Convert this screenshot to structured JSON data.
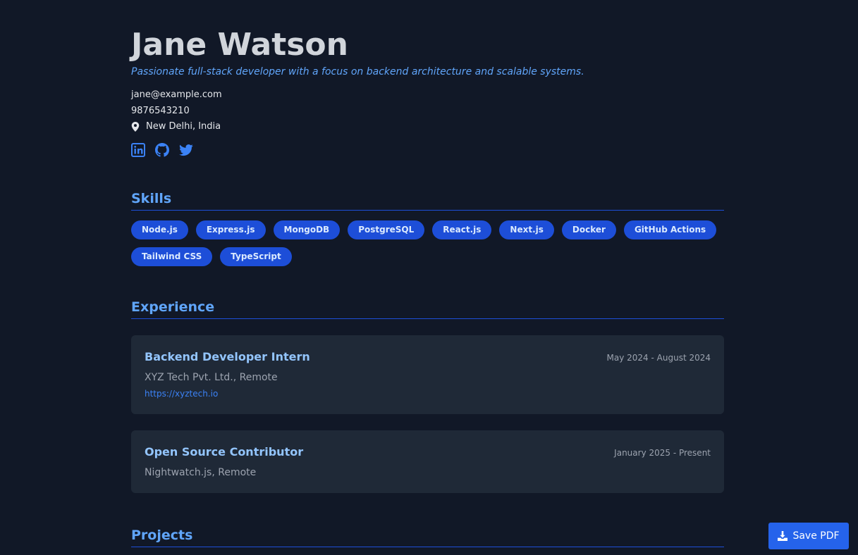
{
  "profile": {
    "name": "Jane Watson",
    "tagline": "Passionate full-stack developer with a focus on backend architecture and scalable systems.",
    "email": "jane@example.com",
    "phone": "9876543210",
    "location": "New Delhi, India"
  },
  "socials": [
    {
      "icon": "linkedin-icon"
    },
    {
      "icon": "github-icon"
    },
    {
      "icon": "twitter-icon"
    }
  ],
  "sections": {
    "skills": "Skills",
    "experience": "Experience",
    "projects": "Projects"
  },
  "skills": [
    "Node.js",
    "Express.js",
    "MongoDB",
    "PostgreSQL",
    "React.js",
    "Next.js",
    "Docker",
    "GitHub Actions",
    "Tailwind CSS",
    "TypeScript"
  ],
  "experience": [
    {
      "title": "Backend Developer Intern",
      "dates": "May 2024 - August 2024",
      "company": "XYZ Tech Pvt. Ltd., Remote",
      "link": "https://xyztech.io"
    },
    {
      "title": "Open Source Contributor",
      "dates": "January 2025 - Present",
      "company": "Nightwatch.js, Remote"
    }
  ],
  "actions": {
    "save_pdf_label": "Save PDF"
  },
  "colors": {
    "background": "#111827",
    "accent": "#60a5fa",
    "chip": "#1d4ed8",
    "card": "#1f2937",
    "button": "#2563eb"
  }
}
